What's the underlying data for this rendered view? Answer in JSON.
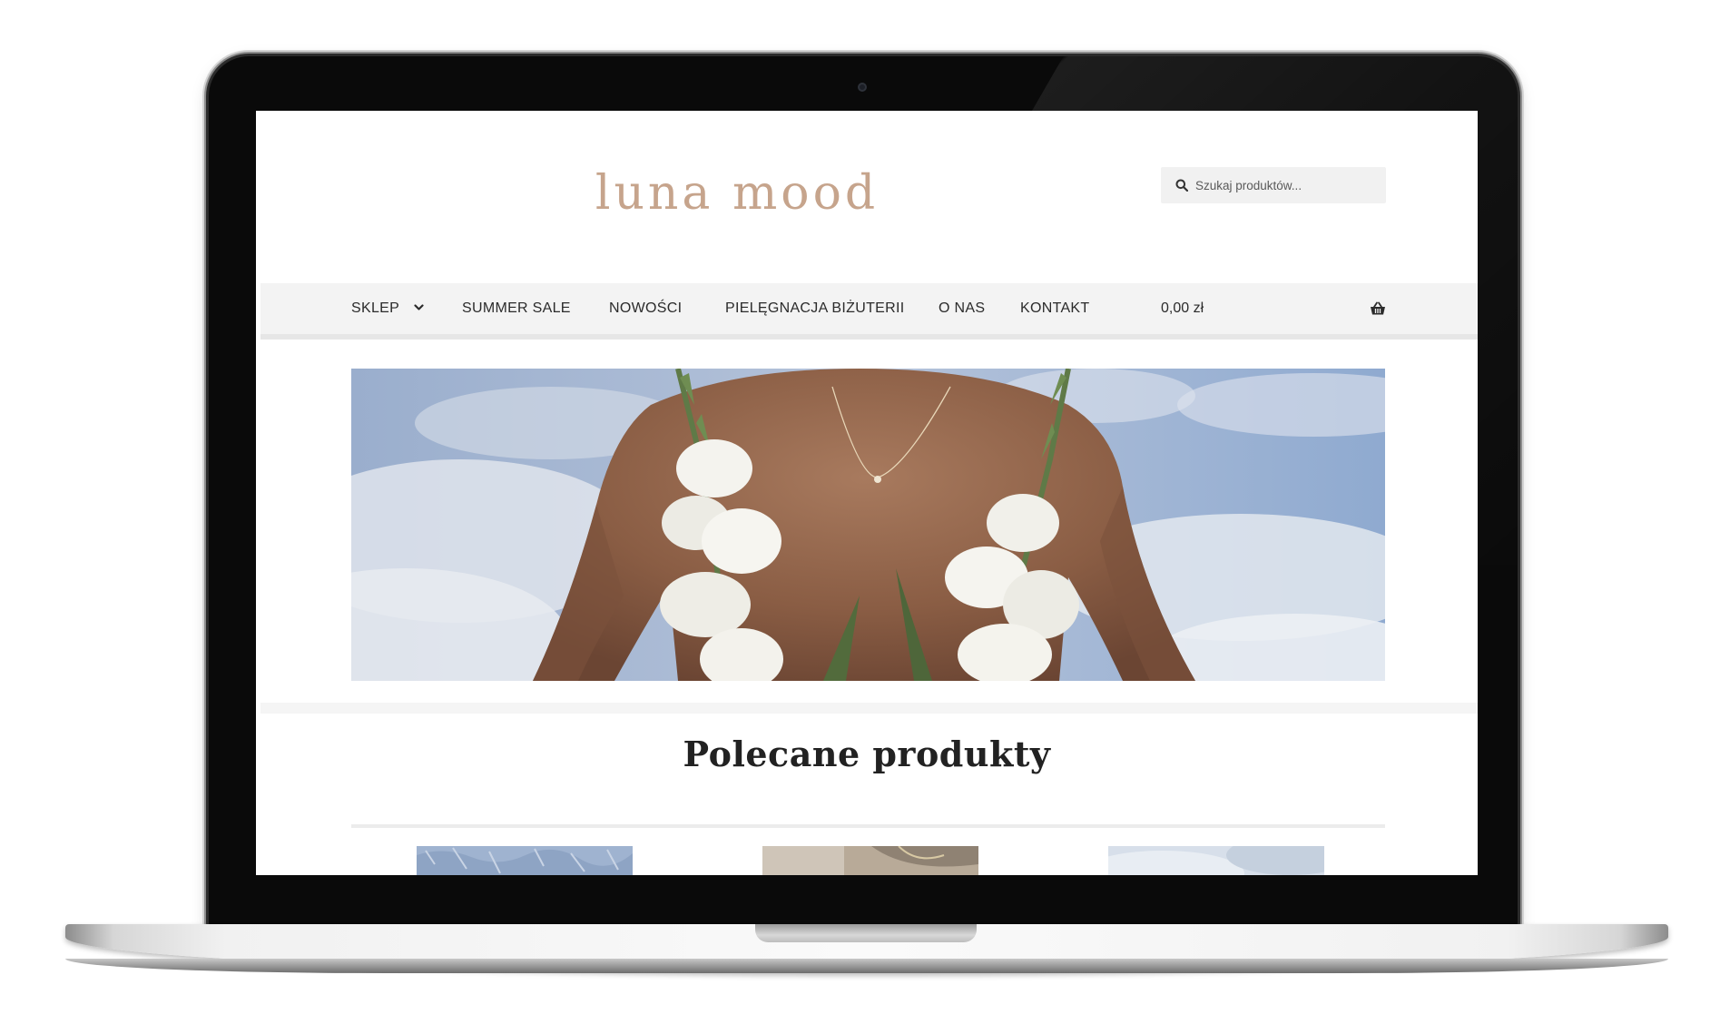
{
  "site": {
    "logo": "luna mood",
    "search": {
      "placeholder": "Szukaj produktów..."
    },
    "nav": [
      {
        "label": "SKLEP",
        "has_dropdown": true
      },
      {
        "label": "SUMMER SALE"
      },
      {
        "label": "NOWOŚCI"
      },
      {
        "label": "PIELĘGNACJA BIŻUTERII"
      },
      {
        "label": "O NAS"
      },
      {
        "label": "KONTAKT"
      }
    ],
    "cart": {
      "total": "0,00 zł"
    },
    "products": {
      "title": "Polecane produkty"
    }
  },
  "colors": {
    "logo": "#c6a48c",
    "nav_bg": "#f3f3f3",
    "text": "#2b2b2b"
  },
  "icons": [
    "search-icon",
    "chevron-down-icon",
    "basket-icon",
    "camera-icon"
  ]
}
